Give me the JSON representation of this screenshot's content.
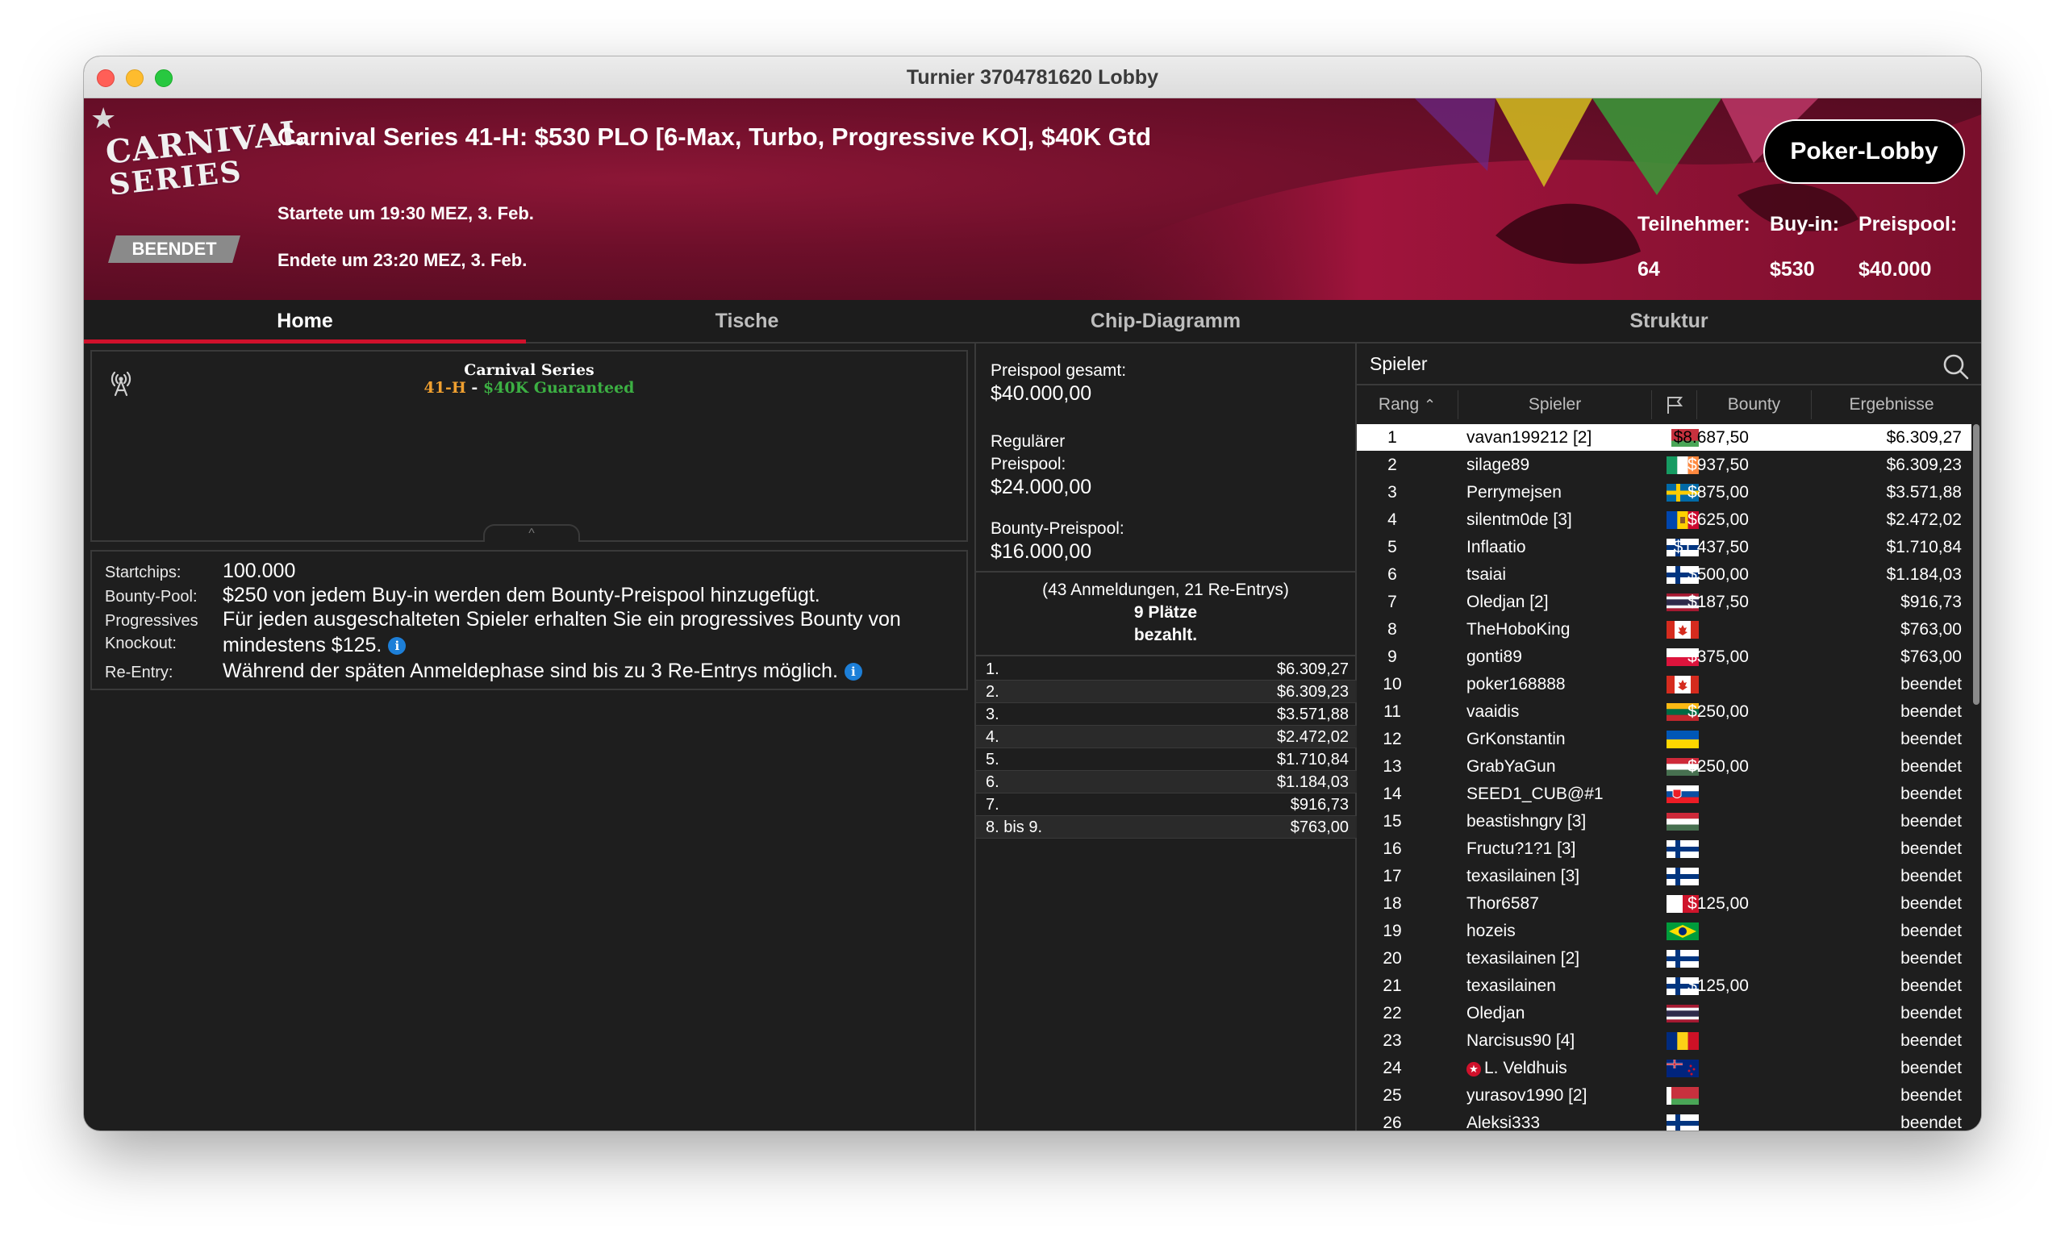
{
  "window": {
    "title": "Turnier 3704781620 Lobby"
  },
  "banner": {
    "tournament_title": "Carnival Series 41-H: $530 PLO [6-Max, Turbo, Progressive KO], $40K Gtd",
    "started": "Startete um 19:30 MEZ, 3. Feb.",
    "ended": "Endete um 23:20 MEZ, 3. Feb.",
    "status": "BEENDET",
    "logo": {
      "line1": "CARNIVAL",
      "line2": "SERIES"
    },
    "lobby_button": "Poker-Lobby",
    "stats": [
      {
        "label": "Teilnehmer:",
        "value": "64"
      },
      {
        "label": "Buy-in:",
        "value": "$530"
      },
      {
        "label": "Preispool:",
        "value": "$40.000"
      }
    ]
  },
  "tabs": [
    {
      "label": "Home",
      "active": true
    },
    {
      "label": "Tische",
      "active": false
    },
    {
      "label": "Chip-Diagramm",
      "active": false
    },
    {
      "label": "Struktur",
      "active": false
    }
  ],
  "home_banner": {
    "line1": "Carnival Series",
    "line2_a": "41-H",
    "line2_sep": " - ",
    "line2_b": "$40K Guaranteed",
    "color_a": "#f0a030",
    "color_b": "#3cb043"
  },
  "info": {
    "startchips_label": "Startchips:",
    "startchips_value": "100.000",
    "bountypool_label": "Bounty-Pool:",
    "bountypool_value": "$250 von jedem Buy-in werden dem Bounty-Preispool hinzugefügt.",
    "pko_label_1": "Progressives",
    "pko_label_2": "Knockout:",
    "pko_value": "Für jeden ausgeschalteten Spieler erhalten Sie ein progressives Bounty von mindestens $125.",
    "reentry_label": "Re-Entry:",
    "reentry_value": "Während der späten Anmeldephase sind bis zu 3 Re-Entrys möglich.",
    "info_glyph": "i"
  },
  "prizepool": {
    "total_label": "Preispool gesamt:",
    "total_value": "$40.000,00",
    "regular_label_1": "Regulärer",
    "regular_label_2": "Preispool:",
    "regular_value": "$24.000,00",
    "bounty_label": "Bounty-Preispool:",
    "bounty_value": "$16.000,00",
    "registrations": "(43 Anmeldungen, 21 Re-Entrys)",
    "places_paid_1": "9 Plätze",
    "places_paid_2": "bezahlt.",
    "payouts": [
      {
        "pos": "1.",
        "amount": "$6.309,27"
      },
      {
        "pos": "2.",
        "amount": "$6.309,23"
      },
      {
        "pos": "3.",
        "amount": "$3.571,88"
      },
      {
        "pos": "4.",
        "amount": "$2.472,02"
      },
      {
        "pos": "5.",
        "amount": "$1.710,84"
      },
      {
        "pos": "6.",
        "amount": "$1.184,03"
      },
      {
        "pos": "7.",
        "amount": "$916,73"
      },
      {
        "pos": "8. bis 9.",
        "amount": "$763,00"
      }
    ]
  },
  "players": {
    "title": "Spieler",
    "columns": {
      "rank": "Rang",
      "player": "Spieler",
      "bounty": "Bounty",
      "result": "Ergebnisse"
    },
    "rows": [
      {
        "rank": "1",
        "name": "vavan199212 [2]",
        "flag": "belarus",
        "bounty": "$8.687,50",
        "result": "$6.309,27",
        "selected": true
      },
      {
        "rank": "2",
        "name": "silage89",
        "flag": "ireland",
        "bounty": "$937,50",
        "result": "$6.309,23"
      },
      {
        "rank": "3",
        "name": "Perrymejsen",
        "flag": "sweden",
        "bounty": "$875,00",
        "result": "$3.571,88"
      },
      {
        "rank": "4",
        "name": "silentm0de [3]",
        "flag": "moldova",
        "bounty": "$625,00",
        "result": "$2.472,02"
      },
      {
        "rank": "5",
        "name": "Inflaatio",
        "flag": "finland",
        "bounty": "$1.437,50",
        "result": "$1.710,84"
      },
      {
        "rank": "6",
        "name": "tsaiai",
        "flag": "finland",
        "bounty": "$500,00",
        "result": "$1.184,03"
      },
      {
        "rank": "7",
        "name": "Oledjan [2]",
        "flag": "thailand",
        "bounty": "$187,50",
        "result": "$916,73"
      },
      {
        "rank": "8",
        "name": "TheHoboKing",
        "flag": "canada",
        "bounty": "",
        "result": "$763,00"
      },
      {
        "rank": "9",
        "name": "gonti89",
        "flag": "poland",
        "bounty": "$375,00",
        "result": "$763,00"
      },
      {
        "rank": "10",
        "name": "poker168888",
        "flag": "canada",
        "bounty": "",
        "result": "beendet"
      },
      {
        "rank": "11",
        "name": "vaaidis",
        "flag": "lithuania",
        "bounty": "$250,00",
        "result": "beendet"
      },
      {
        "rank": "12",
        "name": "GrKonstantin",
        "flag": "ukraine",
        "bounty": "",
        "result": "beendet"
      },
      {
        "rank": "13",
        "name": "GrabYaGun",
        "flag": "hungary",
        "bounty": "$250,00",
        "result": "beendet"
      },
      {
        "rank": "14",
        "name": "SEED1_CUB@#1",
        "flag": "slovakia",
        "bounty": "",
        "result": "beendet"
      },
      {
        "rank": "15",
        "name": "beastishngry [3]",
        "flag": "hungary",
        "bounty": "",
        "result": "beendet"
      },
      {
        "rank": "16",
        "name": "Fructu?1?1 [3]",
        "flag": "finland",
        "bounty": "",
        "result": "beendet"
      },
      {
        "rank": "17",
        "name": "texasilainen [3]",
        "flag": "finland",
        "bounty": "",
        "result": "beendet"
      },
      {
        "rank": "18",
        "name": "Thor6587",
        "flag": "malta",
        "bounty": "$125,00",
        "result": "beendet"
      },
      {
        "rank": "19",
        "name": "hozeis",
        "flag": "brazil",
        "bounty": "",
        "result": "beendet"
      },
      {
        "rank": "20",
        "name": "texasilainen [2]",
        "flag": "finland",
        "bounty": "",
        "result": "beendet"
      },
      {
        "rank": "21",
        "name": "texasilainen",
        "flag": "finland",
        "bounty": "$125,00",
        "result": "beendet"
      },
      {
        "rank": "22",
        "name": "Oledjan",
        "flag": "thailand",
        "bounty": "",
        "result": "beendet"
      },
      {
        "rank": "23",
        "name": "Narcisus90 [4]",
        "flag": "romania",
        "bounty": "",
        "result": "beendet"
      },
      {
        "rank": "24",
        "name": "L. Veldhuis",
        "flag": "newzealand",
        "bounty": "",
        "result": "beendet",
        "star": true
      },
      {
        "rank": "25",
        "name": "yurasov1990 [2]",
        "flag": "belarus",
        "bounty": "",
        "result": "beendet"
      },
      {
        "rank": "26",
        "name": "Aleksi333",
        "flag": "finland",
        "bounty": "",
        "result": "beendet"
      }
    ]
  },
  "colors": {
    "accent": "#d0112b",
    "background": "#1e1e1e",
    "banner": "#6e0f2a"
  }
}
